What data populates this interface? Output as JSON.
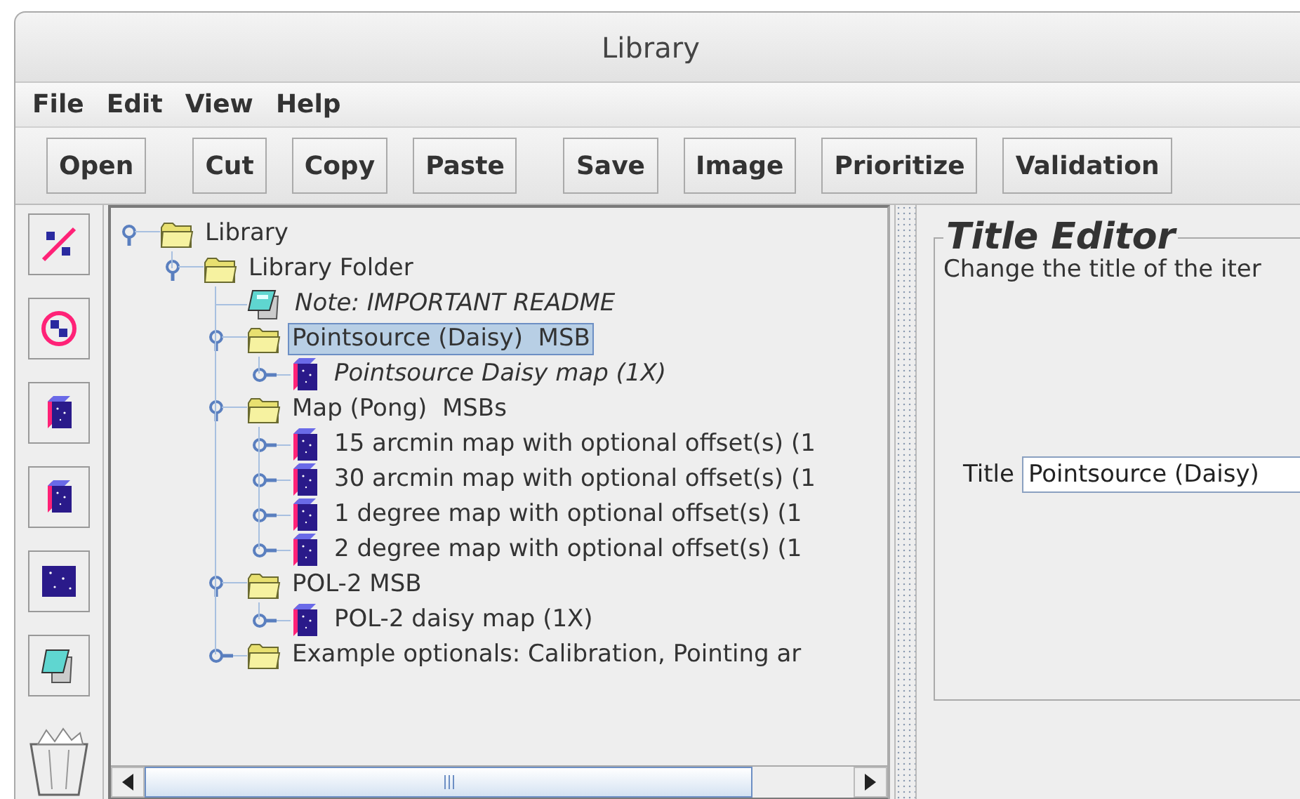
{
  "window": {
    "title": "Library"
  },
  "menu": [
    "File",
    "Edit",
    "View",
    "Help"
  ],
  "toolbar": {
    "groups": [
      [
        "Open"
      ],
      [
        "Cut",
        "Copy",
        "Paste"
      ],
      [
        "Save",
        "Image",
        "Prioritize",
        "Validation"
      ]
    ]
  },
  "tree": [
    {
      "label": "Library",
      "kind": "folder",
      "expandable": true,
      "expanded": true,
      "selected": false,
      "italic": false,
      "children": [
        {
          "label": "Library Folder",
          "kind": "folder",
          "expandable": true,
          "expanded": true,
          "selected": false,
          "italic": false,
          "children": [
            {
              "label": "Note: IMPORTANT README",
              "kind": "note",
              "expandable": false,
              "selected": false,
              "italic": true
            },
            {
              "label": "Pointsource (Daisy)  MSB",
              "kind": "folder",
              "expandable": true,
              "expanded": true,
              "selected": true,
              "italic": false,
              "children": [
                {
                  "label": "Pointsource Daisy map (1X)",
                  "kind": "observation",
                  "expandable": true,
                  "expanded": false,
                  "selected": false,
                  "italic": true
                }
              ]
            },
            {
              "label": "Map (Pong)  MSBs",
              "kind": "folder",
              "expandable": true,
              "expanded": true,
              "selected": false,
              "italic": false,
              "children": [
                {
                  "label": "15 arcmin map with optional offset(s) (1",
                  "kind": "observation",
                  "expandable": true,
                  "expanded": false,
                  "selected": false,
                  "italic": false
                },
                {
                  "label": "30 arcmin map with optional offset(s) (1",
                  "kind": "observation",
                  "expandable": true,
                  "expanded": false,
                  "selected": false,
                  "italic": false
                },
                {
                  "label": "1 degree map with optional offset(s) (1",
                  "kind": "observation",
                  "expandable": true,
                  "expanded": false,
                  "selected": false,
                  "italic": false
                },
                {
                  "label": "2 degree map with optional offset(s) (1",
                  "kind": "observation",
                  "expandable": true,
                  "expanded": false,
                  "selected": false,
                  "italic": false
                }
              ]
            },
            {
              "label": "POL-2 MSB",
              "kind": "folder",
              "expandable": true,
              "expanded": true,
              "selected": false,
              "italic": false,
              "children": [
                {
                  "label": "POL-2 daisy map (1X)",
                  "kind": "observation",
                  "expandable": true,
                  "expanded": false,
                  "selected": false,
                  "italic": false
                }
              ]
            },
            {
              "label": "Example optionals: Calibration, Pointing ar",
              "kind": "folder",
              "expandable": true,
              "expanded": false,
              "selected": false,
              "italic": false
            }
          ]
        }
      ]
    }
  ],
  "editor": {
    "heading": "Title Editor",
    "description": "Change the title of the iter",
    "field_label": "Title",
    "field_value": "Pointsource (Daisy)"
  }
}
